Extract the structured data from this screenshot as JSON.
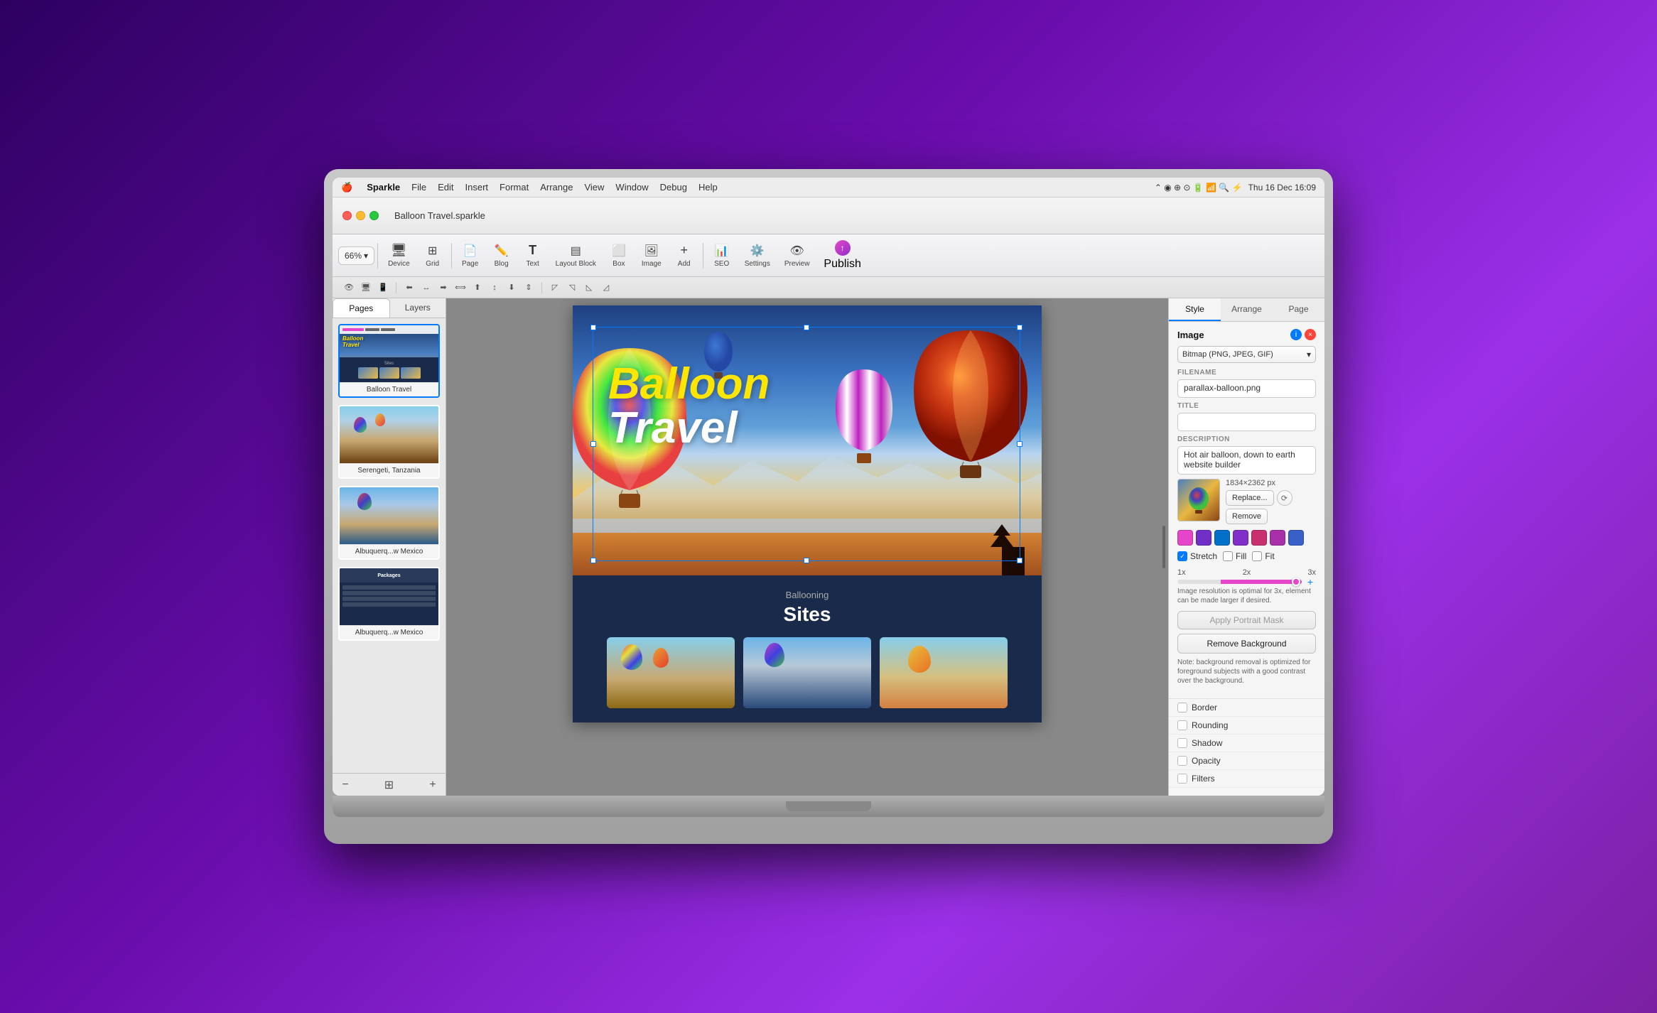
{
  "menubar": {
    "apple": "🍎",
    "app_name": "Sparkle",
    "items": [
      "File",
      "Edit",
      "Insert",
      "Format",
      "Arrange",
      "View",
      "Window",
      "Debug",
      "Help"
    ],
    "right": "Thu 16 Dec  16:09"
  },
  "titlebar": {
    "title": "Balloon Travel.sparkle"
  },
  "toolbar": {
    "zoom_label": "66%",
    "zoom_chevron": "▾",
    "items": [
      {
        "id": "device",
        "icon": "🖥",
        "label": "Device"
      },
      {
        "id": "grid",
        "icon": "⊞",
        "label": "Grid"
      },
      {
        "id": "page",
        "icon": "📄",
        "label": "Page"
      },
      {
        "id": "blog",
        "icon": "✏️",
        "label": "Blog"
      },
      {
        "id": "text",
        "icon": "T",
        "label": "Text"
      },
      {
        "id": "layout-block",
        "icon": "▤",
        "label": "Layout Block"
      },
      {
        "id": "box",
        "icon": "□",
        "label": "Box"
      },
      {
        "id": "image",
        "icon": "🖼",
        "label": "Image"
      },
      {
        "id": "add",
        "icon": "+",
        "label": "Add"
      },
      {
        "id": "seo",
        "icon": "📊",
        "label": "SEO"
      },
      {
        "id": "settings",
        "icon": "⚙",
        "label": "Settings"
      },
      {
        "id": "preview",
        "icon": "👁",
        "label": "Preview"
      },
      {
        "id": "publish",
        "icon": "↑",
        "label": "Publish"
      }
    ]
  },
  "sidebar": {
    "tabs": [
      "Pages",
      "Layers"
    ],
    "active_tab": "Pages",
    "pages": [
      {
        "id": "balloon-travel",
        "label": "Balloon Travel",
        "selected": true
      },
      {
        "id": "serengeti",
        "label": "Serengeti, Tanzania",
        "selected": false
      },
      {
        "id": "albuquerque",
        "label": "Albuquerq...w Mexico",
        "selected": false
      },
      {
        "id": "albuquerque2",
        "label": "Albuquerq...w Mexico",
        "selected": false
      }
    ]
  },
  "canvas": {
    "hero": {
      "title_line1": "Balloon",
      "title_line2": "Travel"
    },
    "bottom": {
      "section_label": "Ballooning",
      "sites_title": "Sites"
    }
  },
  "right_panel": {
    "tabs": [
      "Style",
      "Arrange",
      "Page"
    ],
    "active_tab": "Style",
    "image_section": {
      "title": "Image",
      "bitmap_type": "Bitmap (PNG, JPEG, GIF)",
      "filename_label": "FILENAME",
      "filename_value": "parallax-balloon.png",
      "title_label": "TITLE",
      "title_value": "",
      "description_label": "DESCRIPTION",
      "description_value": "Hot air balloon, down to earth website builder",
      "dimensions": "1834×2362 px",
      "replace_btn": "Replace...",
      "remove_btn": "Remove"
    },
    "display_mode": {
      "stretch_label": "Stretch",
      "fill_label": "Fill",
      "fit_label": "Fit",
      "stretch_checked": true
    },
    "resolution": {
      "labels": [
        "1x",
        "2x",
        "3x"
      ],
      "info": "Image resolution is optimal for 3x, element can be made larger if desired."
    },
    "portrait_mask": {
      "apply_label": "Apply Portrait Mask",
      "disabled": true
    },
    "remove_bg": {
      "label": "Remove Background",
      "note": "Note: background removal is optimized for foreground subjects with a good contrast over the background."
    },
    "checkboxes": [
      {
        "id": "border",
        "label": "Border",
        "checked": false
      },
      {
        "id": "rounding",
        "label": "Rounding",
        "checked": false
      },
      {
        "id": "shadow",
        "label": "Shadow",
        "checked": false
      },
      {
        "id": "opacity",
        "label": "Opacity",
        "checked": false
      },
      {
        "id": "filters",
        "label": "Filters",
        "checked": false
      }
    ]
  },
  "colors": {
    "accent_blue": "#007aff",
    "accent_pink": "#e545c8",
    "accent_purple": "#9030c8",
    "toolbar_bg": "#ebebeb",
    "panel_bg": "#f5f5f5",
    "dark_navy": "#1a2a4a",
    "balloon_yellow": "#ffe600"
  }
}
